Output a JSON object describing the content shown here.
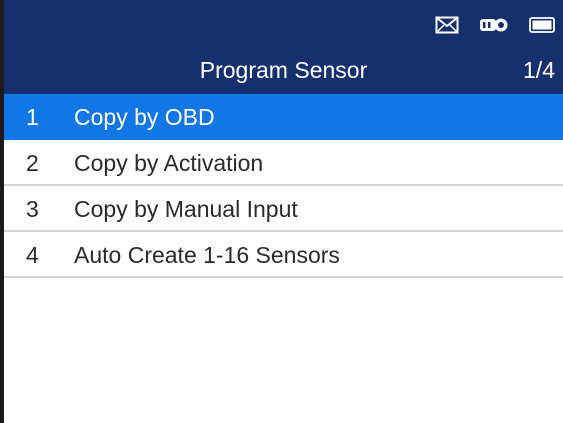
{
  "header": {
    "title": "Program Sensor",
    "page_indicator": "1/4",
    "status_icons": [
      "mail-icon",
      "obd-connector-icon",
      "battery-icon"
    ]
  },
  "menu": {
    "items": [
      {
        "number": "1",
        "label": "Copy by OBD",
        "selected": true
      },
      {
        "number": "2",
        "label": "Copy by Activation",
        "selected": false
      },
      {
        "number": "3",
        "label": "Copy by Manual Input",
        "selected": false
      },
      {
        "number": "4",
        "label": "Auto Create 1-16 Sensors",
        "selected": false
      }
    ]
  },
  "colors": {
    "header_bg": "#16306e",
    "selected_bg": "#1277e6",
    "divider": "#d4d4d4",
    "text": "#2a2a2a"
  }
}
